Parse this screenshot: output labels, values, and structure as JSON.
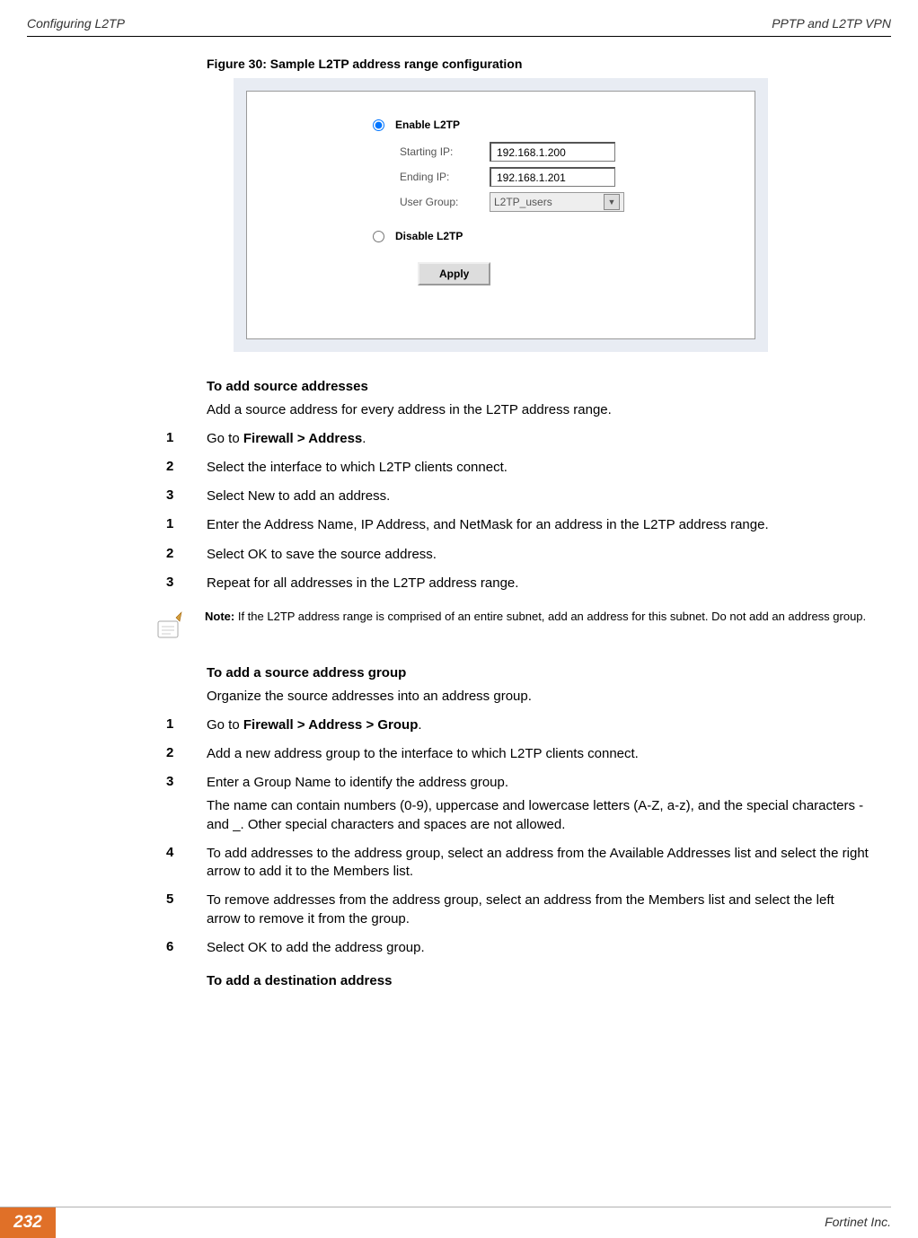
{
  "header": {
    "left": "Configuring L2TP",
    "right": "PPTP and L2TP VPN"
  },
  "figure_caption": "Figure 30: Sample L2TP address range configuration",
  "form": {
    "radio_enable": "Enable L2TP",
    "radio_disable": "Disable L2TP",
    "starting_ip_label": "Starting IP:",
    "starting_ip_value": "192.168.1.200",
    "ending_ip_label": "Ending IP:",
    "ending_ip_value": "192.168.1.201",
    "user_group_label": "User Group:",
    "user_group_value": "L2TP_users",
    "apply_label": "Apply"
  },
  "section1": {
    "heading": "To add source addresses",
    "intro": "Add a source address for every address in the L2TP address range.",
    "steps_a": [
      {
        "num": "1",
        "text_pre": "Go to ",
        "bold": "Firewall > Address",
        "text_post": "."
      },
      {
        "num": "2",
        "text": "Select the interface to which L2TP clients connect."
      },
      {
        "num": "3",
        "text": "Select New to add an address."
      }
    ],
    "steps_b": [
      {
        "num": "1",
        "text": "Enter the Address Name, IP Address, and NetMask for an address in the L2TP address range."
      },
      {
        "num": "2",
        "text": "Select OK to save the source address."
      },
      {
        "num": "3",
        "text": "Repeat for all addresses in the L2TP address range."
      }
    ]
  },
  "note": {
    "label": "Note: ",
    "text": "If the L2TP address range is comprised of an entire subnet, add an address for this subnet. Do not add an address group."
  },
  "section2": {
    "heading": "To add a source address group",
    "intro": "Organize the source addresses into an address group.",
    "steps": [
      {
        "num": "1",
        "text_pre": "Go to ",
        "bold": "Firewall > Address > Group",
        "text_post": "."
      },
      {
        "num": "2",
        "text": "Add a new address group to the interface to which L2TP clients connect."
      },
      {
        "num": "3",
        "text": "Enter a Group Name to identify the address group.",
        "sub": "The name can contain numbers (0-9), uppercase and lowercase letters (A-Z, a-z), and the special characters - and _. Other special characters and spaces are not allowed."
      },
      {
        "num": "4",
        "text": "To add addresses to the address group, select an address from the Available Addresses list and select the right arrow to add it to the Members list."
      },
      {
        "num": "5",
        "text": "To remove addresses from the address group, select an address from the Members list and select the left arrow to remove it from the group."
      },
      {
        "num": "6",
        "text": "Select OK to add the address group."
      }
    ]
  },
  "section3": {
    "heading": "To add a destination address"
  },
  "footer": {
    "page_num": "232",
    "right": "Fortinet Inc."
  }
}
